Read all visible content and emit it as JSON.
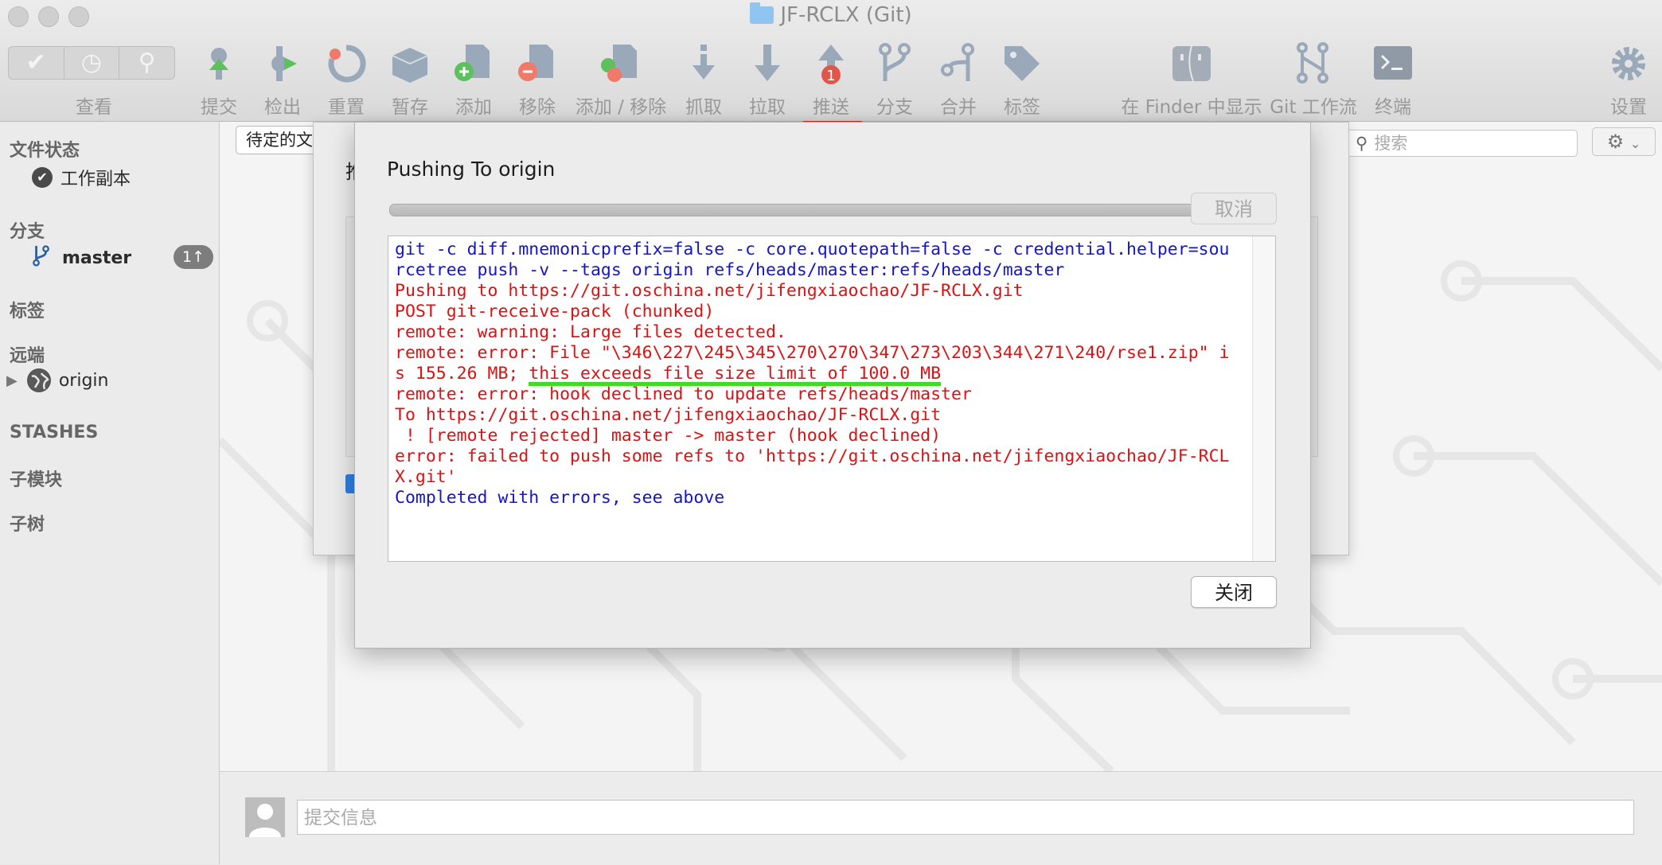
{
  "window": {
    "title": "JF-RCLX (Git)"
  },
  "toolbar": {
    "view_label": "查看",
    "items": [
      {
        "key": "commit",
        "label": "提交",
        "icon": "commit-icon"
      },
      {
        "key": "checkout",
        "label": "检出",
        "icon": "checkout-icon"
      },
      {
        "key": "reset",
        "label": "重置",
        "icon": "reset-icon"
      },
      {
        "key": "stash",
        "label": "暂存",
        "icon": "stash-icon"
      },
      {
        "key": "add",
        "label": "添加",
        "icon": "add-icon"
      },
      {
        "key": "remove",
        "label": "移除",
        "icon": "remove-icon"
      },
      {
        "key": "addremove",
        "label": "添加 / 移除",
        "icon": "add-remove-icon"
      },
      {
        "key": "fetch",
        "label": "抓取",
        "icon": "fetch-icon"
      },
      {
        "key": "pull",
        "label": "拉取",
        "icon": "pull-icon"
      },
      {
        "key": "push",
        "label": "推送",
        "icon": "push-icon",
        "badge": "1"
      },
      {
        "key": "branch",
        "label": "分支",
        "icon": "branch-icon"
      },
      {
        "key": "merge",
        "label": "合并",
        "icon": "merge-icon"
      },
      {
        "key": "tag",
        "label": "标签",
        "icon": "tag-icon"
      },
      {
        "key": "finder",
        "label": "在 Finder 中显示",
        "icon": "finder-icon"
      },
      {
        "key": "gitflow",
        "label": "Git 工作流",
        "icon": "git-flow-icon"
      },
      {
        "key": "terminal",
        "label": "终端",
        "icon": "terminal-icon"
      },
      {
        "key": "settings",
        "label": "设置",
        "icon": "gear-icon"
      }
    ]
  },
  "sidebar": {
    "file_status": "文件状态",
    "working_copy": "工作副本",
    "branches": "分支",
    "master": "master",
    "master_badge": "1↑",
    "tags": "标签",
    "remotes": "远端",
    "origin": "origin",
    "stashes": "STASHES",
    "submodules": "子模块",
    "subtrees": "子树"
  },
  "main": {
    "filter_value": "待定的文",
    "search_placeholder": "搜索",
    "commit_placeholder": "提交信息",
    "back_sheet_title_fragment": "推"
  },
  "dialog": {
    "title": "Pushing To origin",
    "cancel_label": "取消",
    "close_label": "关闭",
    "log": {
      "line1": "git -c diff.mnemonicprefix=false -c core.quotepath=false -c credential.helper=sourcetree push -v --tags origin refs/heads/master:refs/heads/master",
      "line2": "Pushing to https://git.oschina.net/jifengxiaochao/JF-RCLX.git",
      "line3": "POST git-receive-pack (chunked)",
      "line4": "remote: warning: Large files detected.",
      "line5a": "remote: error: File \"\\346\\227\\245\\345\\270\\270\\347\\273\\203\\344\\271\\240/rse1.zip\" is 155.26 MB; ",
      "line5b": "this exceeds file size limit of 100.0 MB",
      "line6": "remote: error: hook declined to update refs/heads/master",
      "line7": "To https://git.oschina.net/jifengxiaochao/JF-RCLX.git",
      "line8": " ! [remote rejected] master -> master (hook declined)",
      "line9": "error: failed to push some refs to 'https://git.oschina.net/jifengxiaochao/JF-RCLX.git'",
      "line10": "Completed with errors, see above"
    }
  },
  "colors": {
    "log_blue": "#1414cc",
    "log_red": "#dd1111",
    "highlight_underline": "#3fdc24",
    "push_marker": "#ee1c1c",
    "toolbar_icon": "#8ea1b6"
  }
}
